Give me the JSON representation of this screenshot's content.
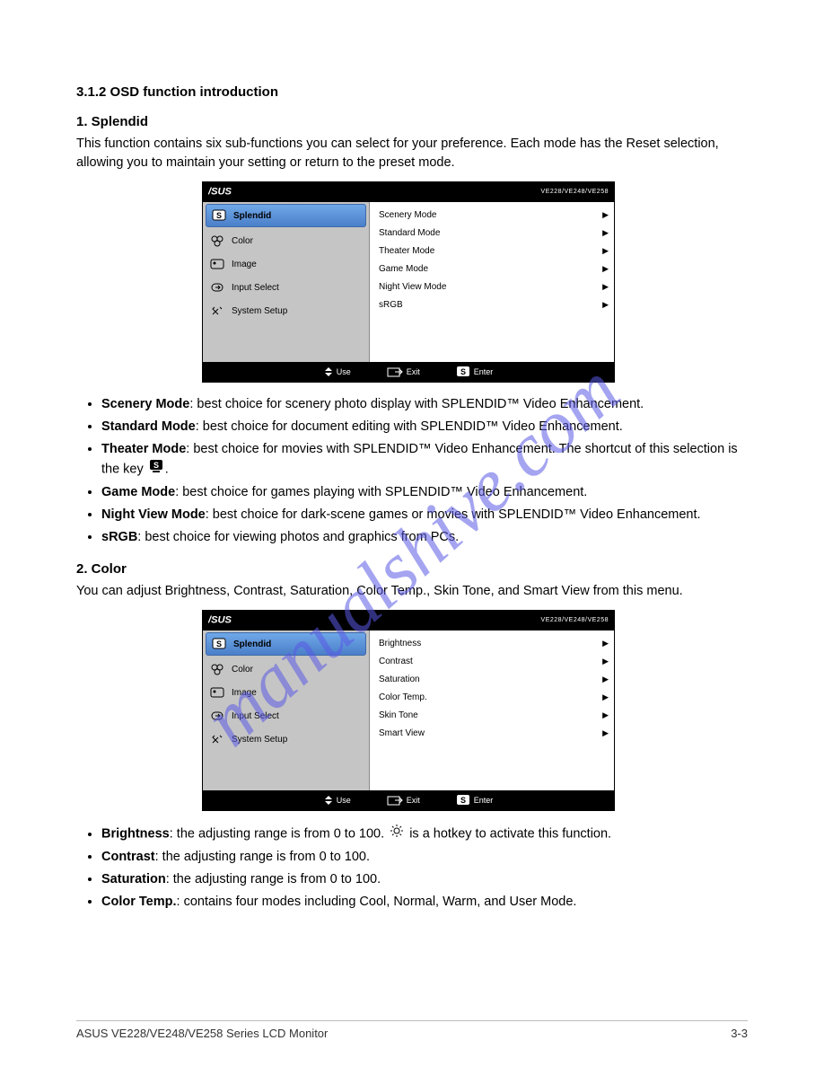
{
  "watermark": "manualshive.com",
  "section1": {
    "heading": "3.1.2   OSD function introduction",
    "subheading": "1.  Splendid",
    "intro": "This function contains six sub-functions you can select for your preference. Each mode has the Reset selection, allowing you to maintain your setting or return to the preset mode."
  },
  "osd1": {
    "model_line1": "VE228/VE248/VE258",
    "left": [
      "Splendid",
      "Color",
      "Image",
      "Input Select",
      "System Setup"
    ],
    "right": [
      "Scenery Mode",
      "Standard Mode",
      "Theater Mode",
      "Game Mode",
      "Night View Mode",
      "sRGB"
    ],
    "footer": {
      "nav": "Use",
      "exit_l": "Exit",
      "enter_l": "Enter"
    }
  },
  "modes": [
    {
      "name": "Scenery Mode",
      "desc": ": best choice for scenery photo display with SPLENDID™ Video Enhancement."
    },
    {
      "name": "Standard Mode",
      "desc": ": best choice for document editing with SPLENDID™ Video Enhancement."
    },
    {
      "name": "Theater Mode",
      "desc": ": best choice for movies with SPLENDID™ Video Enhancement. The shortcut of this selection is the key"
    },
    {
      "name": "Game Mode",
      "desc": ": best choice for games playing with SPLENDID™ Video Enhancement."
    },
    {
      "name": "Night View Mode",
      "desc": ": best choice for dark-scene games or movies with SPLENDID™ Video Enhancement."
    },
    {
      "name": "sRGB",
      "desc": ": best choice for viewing photos and graphics from PCs."
    }
  ],
  "section2": {
    "heading": "2.  Color",
    "intro": "You can adjust Brightness, Contrast, Saturation, Color Temp., Skin Tone, and Smart View from this menu."
  },
  "osd2": {
    "model_line1": "VE228/VE248/VE258",
    "left": [
      "Splendid",
      "Color",
      "Image",
      "Input Select",
      "System Setup"
    ],
    "right": [
      "Brightness",
      "Contrast",
      "Saturation",
      "Color Temp.",
      "Skin Tone",
      "Smart View"
    ],
    "footer": {
      "nav": "Use",
      "exit_l": "Exit",
      "enter_l": "Enter"
    }
  },
  "bullets2": [
    {
      "name": "Brightness",
      "desc": ": the adjusting range is from 0 to 100. ",
      "tail": " is a hotkey to activate this function."
    },
    {
      "name": "Contrast",
      "desc": ": the adjusting range is from 0 to 100."
    },
    {
      "name": "Saturation",
      "desc": ": the adjusting range is from 0 to 100."
    },
    {
      "name": "Color Temp.",
      "desc": ": contains four modes including Cool, Normal, Warm, and User Mode."
    }
  ],
  "footer": {
    "left": "ASUS VE228/VE248/VE258 Series LCD Monitor",
    "right": "3-3"
  }
}
